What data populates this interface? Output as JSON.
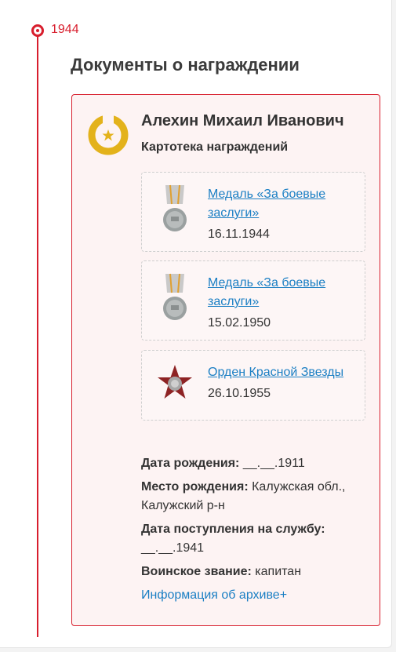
{
  "timeline": {
    "year": "1944"
  },
  "section": {
    "title": "Документы о награждении"
  },
  "person": {
    "name": "Алехин Михаил Иванович",
    "document_type": "Картотека награждений"
  },
  "awards": [
    {
      "title": "Медаль «За боевые заслуги»",
      "date": "16.11.1944",
      "icon": "medal-icon"
    },
    {
      "title": "Медаль «За боевые заслуги»",
      "date": "15.02.1950",
      "icon": "medal-icon"
    },
    {
      "title": "Орден Красной Звезды",
      "date": "26.10.1955",
      "icon": "red-star-order-icon"
    }
  ],
  "info": {
    "birth_date_label": "Дата рождения:",
    "birth_date_value": "__.__.1911",
    "birth_place_label": "Место рождения:",
    "birth_place_value": "Калужская обл., Калужский р-н",
    "service_start_label": "Дата поступления на службу:",
    "service_start_value": "__.__.1941",
    "rank_label": "Воинское звание:",
    "rank_value": "капитан",
    "archive_link": "Информация об архиве+"
  },
  "colors": {
    "accent": "#d81e2d",
    "link": "#1b7fc4",
    "badge": "#e3b21b"
  }
}
